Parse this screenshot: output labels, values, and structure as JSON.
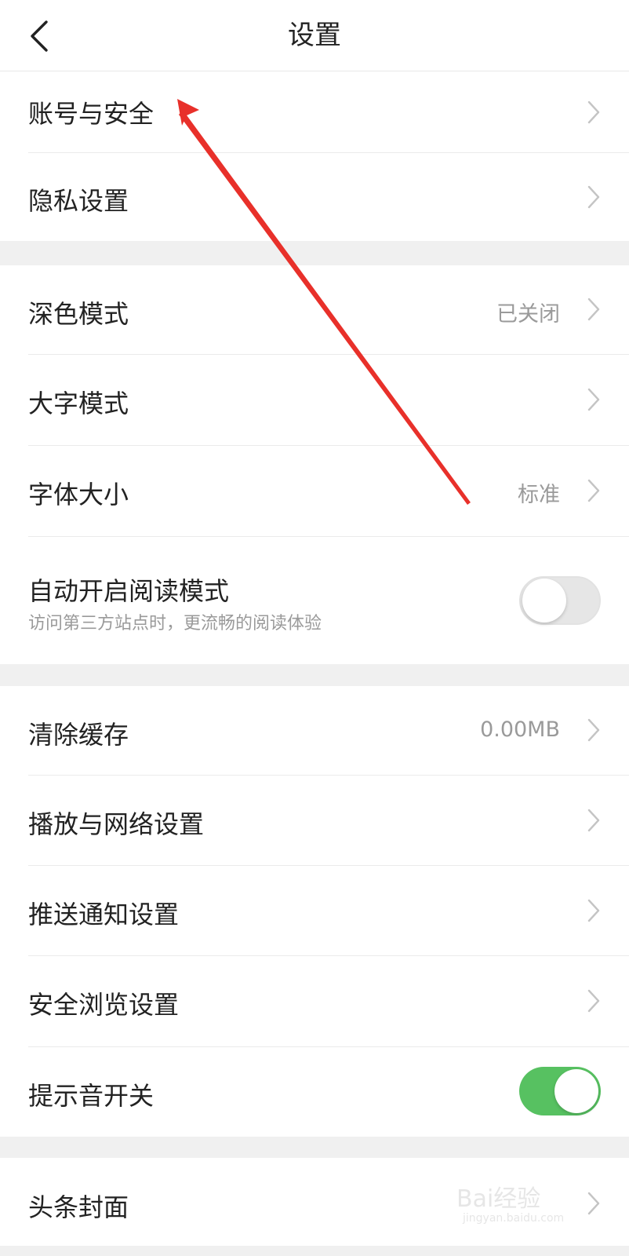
{
  "header": {
    "title": "设置",
    "back_icon": "chevron-left-icon"
  },
  "rows": {
    "account_security": {
      "label": "账号与安全"
    },
    "privacy": {
      "label": "隐私设置"
    },
    "dark_mode": {
      "label": "深色模式",
      "value": "已关闭"
    },
    "large_text": {
      "label": "大字模式"
    },
    "font_size": {
      "label": "字体大小",
      "value": "标准"
    },
    "auto_reader": {
      "label": "自动开启阅读模式",
      "sublabel": "访问第三方站点时，更流畅的阅读体验",
      "toggle": "off"
    },
    "clear_cache": {
      "label": "清除缓存",
      "value": "0.00MB"
    },
    "playback_network": {
      "label": "播放与网络设置"
    },
    "push_notify": {
      "label": "推送通知设置"
    },
    "safe_browse": {
      "label": "安全浏览设置"
    },
    "sound_toggle": {
      "label": "提示音开关",
      "toggle": "on"
    },
    "headline_cover": {
      "label": "头条封面"
    }
  },
  "colors": {
    "toggle_on": "#57c161",
    "toggle_off": "#e6e6e6",
    "annotation_arrow": "#e8302a",
    "section_gap": "#f0f0f0"
  },
  "watermark": {
    "text": "Bai经验",
    "url": "jingyan.baidu.com"
  }
}
